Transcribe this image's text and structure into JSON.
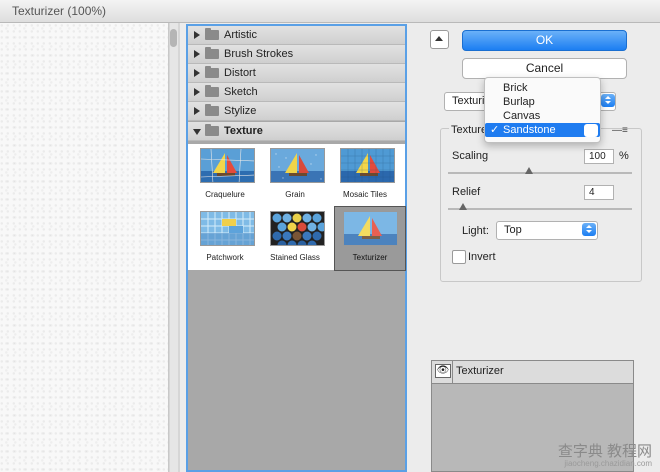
{
  "window": {
    "title": "Texturizer (100%)"
  },
  "gallery": {
    "categories": [
      {
        "label": "Artistic"
      },
      {
        "label": "Brush Strokes"
      },
      {
        "label": "Distort"
      },
      {
        "label": "Sketch"
      },
      {
        "label": "Stylize"
      },
      {
        "label": "Texture"
      }
    ],
    "thumbnails": [
      {
        "label": "Craquelure"
      },
      {
        "label": "Grain"
      },
      {
        "label": "Mosaic Tiles"
      },
      {
        "label": "Patchwork"
      },
      {
        "label": "Stained Glass"
      },
      {
        "label": "Texturizer"
      }
    ]
  },
  "buttons": {
    "ok": "OK",
    "cancel": "Cancel"
  },
  "filter_select": {
    "value": "Texturizer"
  },
  "texture_group": {
    "texture_label": "Texture",
    "scaling_label": "Scaling",
    "scaling_value": "100",
    "scaling_unit": "%",
    "scaling_level": 0.44,
    "relief_label": "Relief",
    "relief_value": "4",
    "relief_level": 0.08,
    "light_label": "Light:",
    "light_value": "Top",
    "invert_label": "Invert"
  },
  "texture_menu": {
    "items": [
      "Brick",
      "Burlap",
      "Canvas",
      "Sandstone"
    ],
    "selected": "Sandstone"
  },
  "layers": {
    "name": "Texturizer"
  },
  "watermark": {
    "line1": "查字典 教程网",
    "line2": "jiaocheng.chazidian.com"
  },
  "colors": {
    "accent": "#1f7cf0",
    "focus_border": "#5aa0e6"
  }
}
